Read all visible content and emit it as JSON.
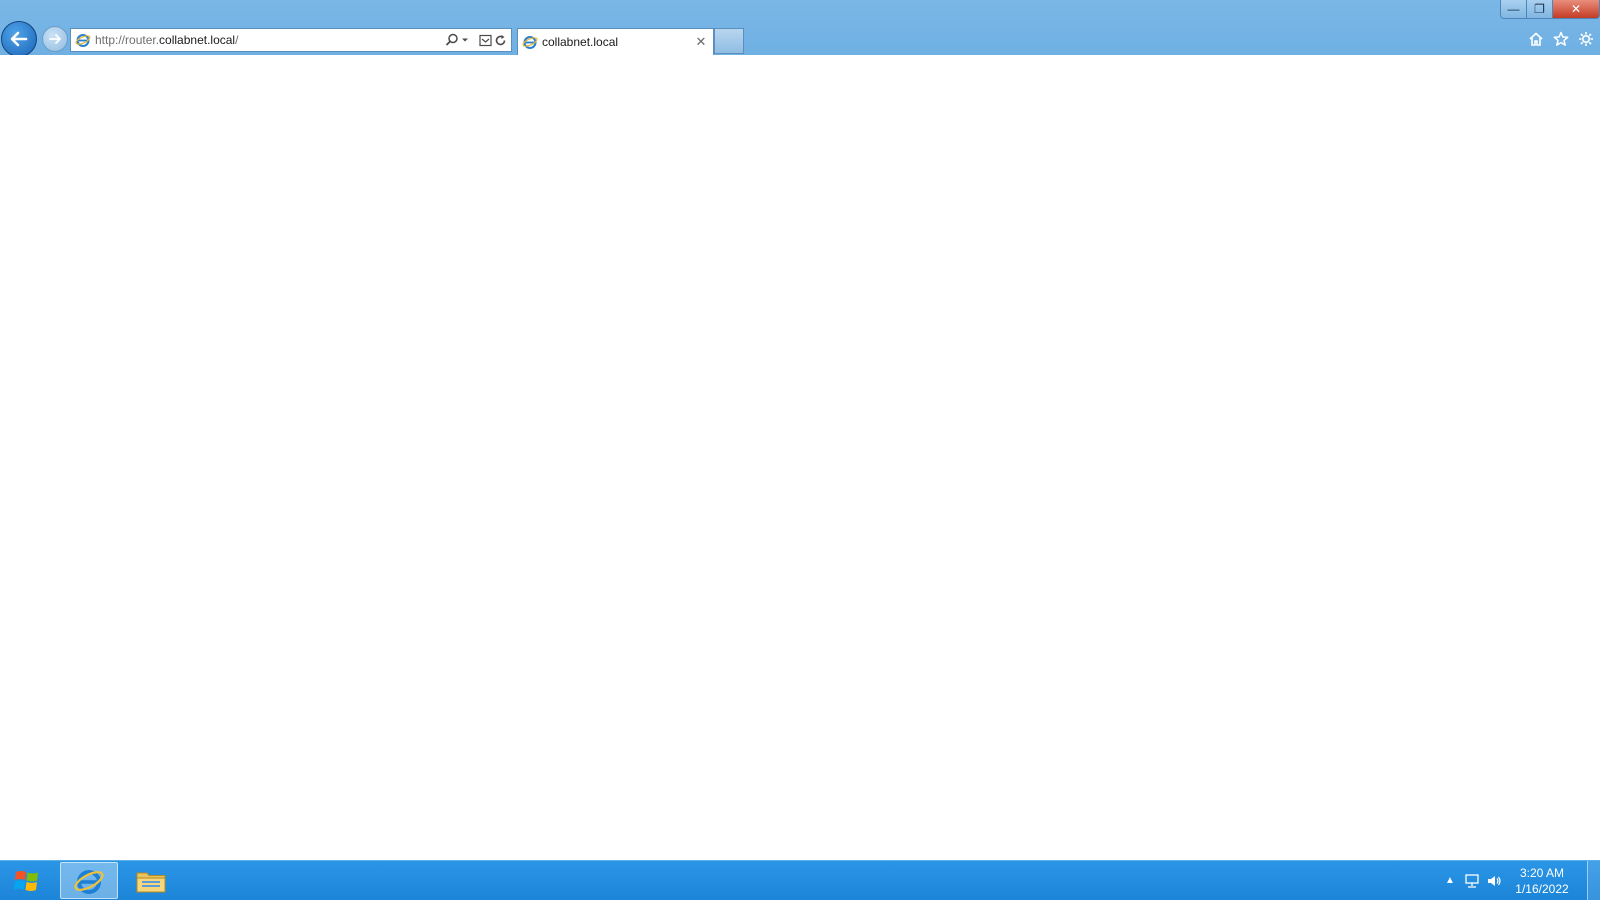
{
  "browser": {
    "address": {
      "url_prefix": "http://router.",
      "url_domain": "collabnet.local",
      "url_suffix": "/"
    },
    "tabs": [
      {
        "title": "collabnet.local",
        "active": true
      }
    ],
    "tab_close_glyph": "✕",
    "window_controls": {
      "minimize": "—",
      "maximize": "❐",
      "close": "✕"
    }
  },
  "taskbar": {
    "pinned": [
      "internet-explorer",
      "file-explorer"
    ],
    "clock": {
      "time": "3:20 AM",
      "date": "1/16/2022"
    },
    "tray_expand_glyph": "▲"
  },
  "colors": {
    "chrome": "#7ab7e6",
    "taskbar": "#1c85d8",
    "back_button": "#1a62b8"
  }
}
